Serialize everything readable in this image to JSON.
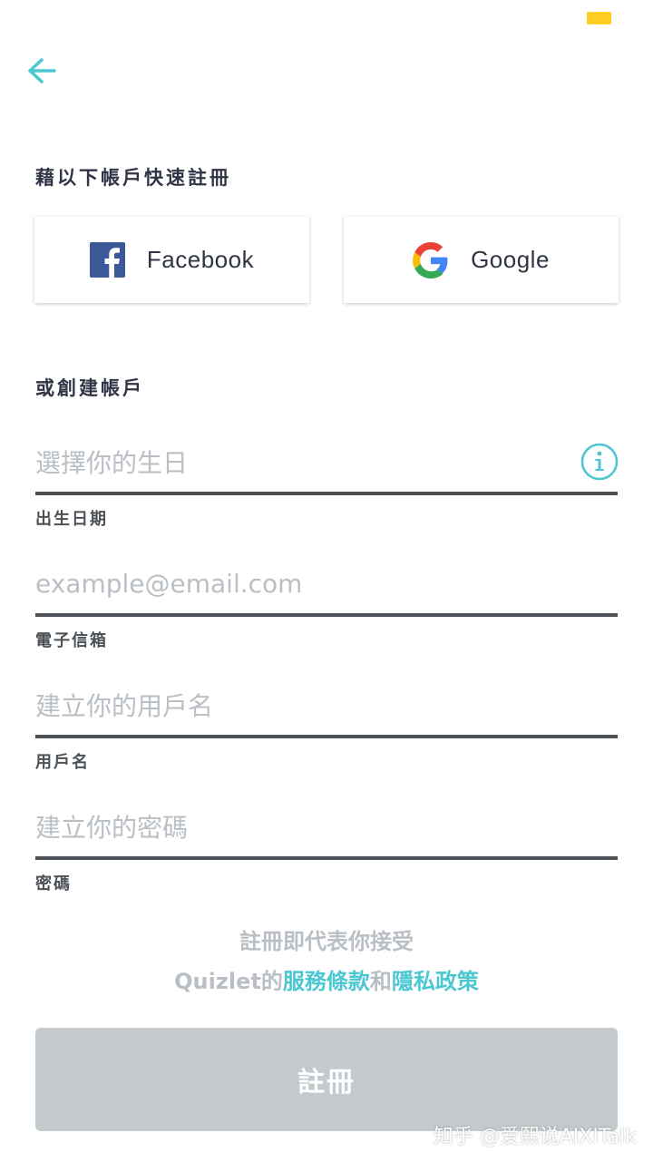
{
  "header": {
    "back_icon": "arrow-left-icon"
  },
  "quick_signup": {
    "title": "藉以下帳戶快速註冊",
    "facebook": {
      "label": "Facebook",
      "icon": "facebook-icon"
    },
    "google": {
      "label": "Google",
      "icon": "google-icon"
    }
  },
  "create_account": {
    "title": "或創建帳戶",
    "fields": [
      {
        "placeholder": "選擇你的生日",
        "caption": "出生日期",
        "icon": "info-icon"
      },
      {
        "placeholder": "example@email.com",
        "caption": "電子信箱"
      },
      {
        "placeholder": "建立你的用戶名",
        "caption": "用戶名"
      },
      {
        "placeholder": "建立你的密碼",
        "caption": "密碼"
      }
    ]
  },
  "terms": {
    "line1": "註冊即代表你接受",
    "prefix": "Quizlet的",
    "tos_link": "服務條款",
    "conjunction": "和",
    "privacy_link": "隱私政策"
  },
  "signup_button": {
    "label": "註冊"
  },
  "watermark": "知乎 @爱熙说AIXITalk",
  "colors": {
    "accent": "#4bc7d1",
    "status_badge": "#ffcd1f",
    "button_disabled": "#c3c9cc",
    "underline": "#4b5156"
  }
}
